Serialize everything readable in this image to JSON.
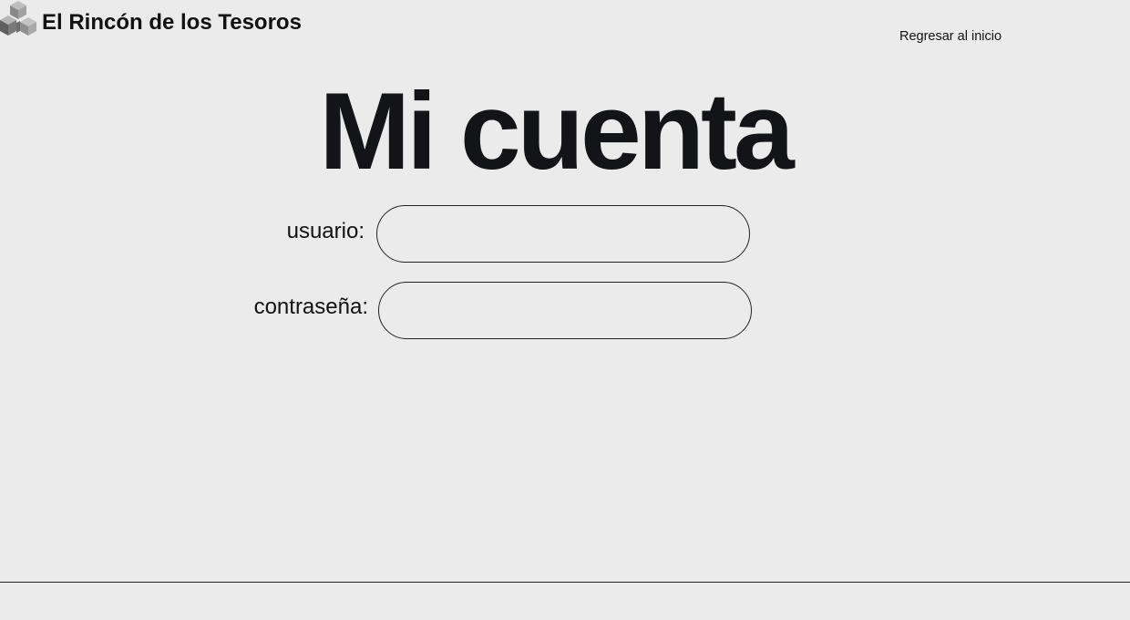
{
  "header": {
    "brand_name": "El Rincón de los Tesoros",
    "logo_icon": "cubes-logo-icon",
    "home_link_label": "Regresar al inicio"
  },
  "main": {
    "title": "Mi cuenta",
    "form": {
      "username_label": "usuario:",
      "username_value": "",
      "password_label": "contraseña:",
      "password_value": ""
    }
  },
  "colors": {
    "background": "#ebebeb",
    "text": "#131418",
    "field_border": "#222222",
    "logo_light": "#a9a9a9",
    "logo_mid": "#8a8a8a",
    "logo_dark": "#5e5e5e"
  }
}
